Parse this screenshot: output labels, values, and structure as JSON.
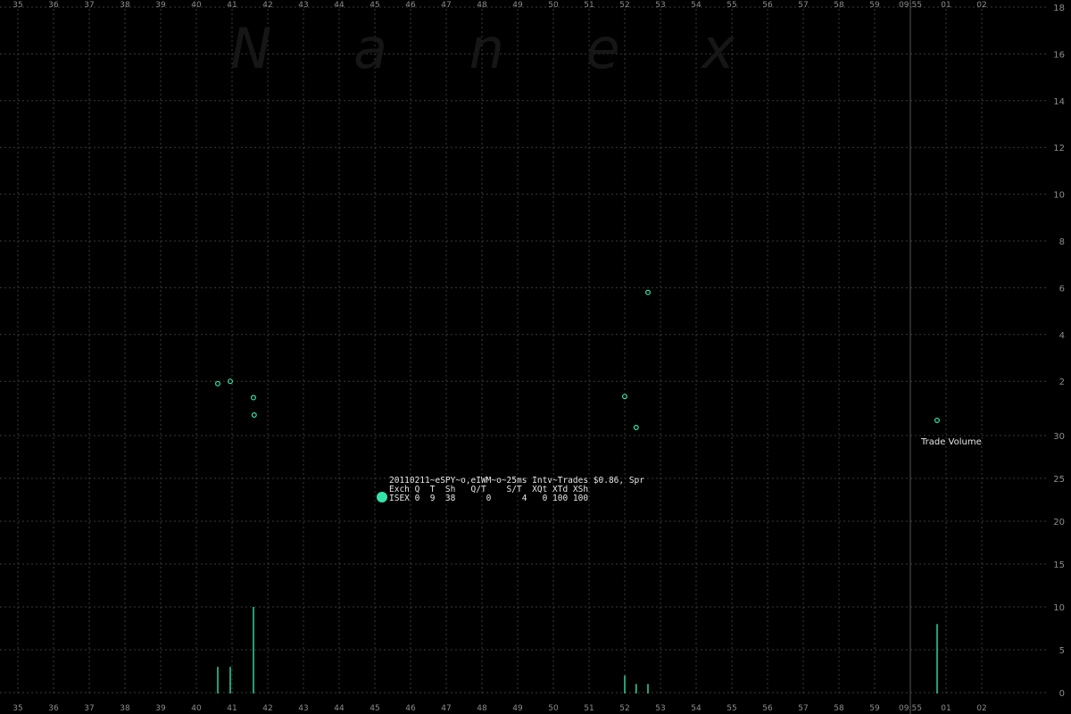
{
  "watermark": "N a n e x",
  "chart_data": {
    "type": "scatter",
    "x_ticks": [
      "35",
      "36",
      "37",
      "38",
      "39",
      "40",
      "41",
      "42",
      "43",
      "44",
      "45",
      "46",
      "47",
      "48",
      "49",
      "50",
      "51",
      "52",
      "53",
      "54",
      "55",
      "56",
      "57",
      "58",
      "59",
      "09:55",
      "01",
      "02"
    ],
    "price_ticks": [
      "18",
      "16",
      "14",
      "12",
      "10",
      "8",
      "6",
      "4",
      "2"
    ],
    "upper_ticks_lower": [
      "30",
      "25",
      "20",
      "15",
      "10",
      "5",
      "0"
    ],
    "grid": true,
    "series": [
      {
        "name": "Trade Volume",
        "type": "bar",
        "points": [
          {
            "x": 40.6,
            "value": 3
          },
          {
            "x": 40.95,
            "value": 3
          },
          {
            "x": 41.6,
            "value": 10
          },
          {
            "x": 52.0,
            "value": 2
          },
          {
            "x": 52.32,
            "value": 1
          },
          {
            "x": 52.65,
            "value": 1
          },
          {
            "x": 60.75,
            "value": 8
          }
        ]
      },
      {
        "type": "scatter",
        "points": [
          {
            "x": 40.6,
            "y": 1.3
          },
          {
            "x": 40.95,
            "y": 1.4
          },
          {
            "x": 41.6,
            "y": 0.7
          },
          {
            "x": 41.62,
            "y": 0.45
          },
          {
            "x": 52.0,
            "y": 0.75
          },
          {
            "x": 52.32,
            "y": -0.1
          },
          {
            "x": 52.65,
            "y": 5.2
          },
          {
            "x": 60.75,
            "y": 0.25
          }
        ]
      }
    ],
    "marker_color": "#34e3a9"
  },
  "info_box": {
    "title": "20110211~eSPY~o,eIWM~o~25ms Intv~Trades $0.86, Spr",
    "header": "Exch Q  T  Sh   Q/T    S/T  XQt XTd XSh",
    "row": "ISEX 0  9  38      0      4   0 100 100"
  },
  "trade_volume_label": "Trade Volume"
}
